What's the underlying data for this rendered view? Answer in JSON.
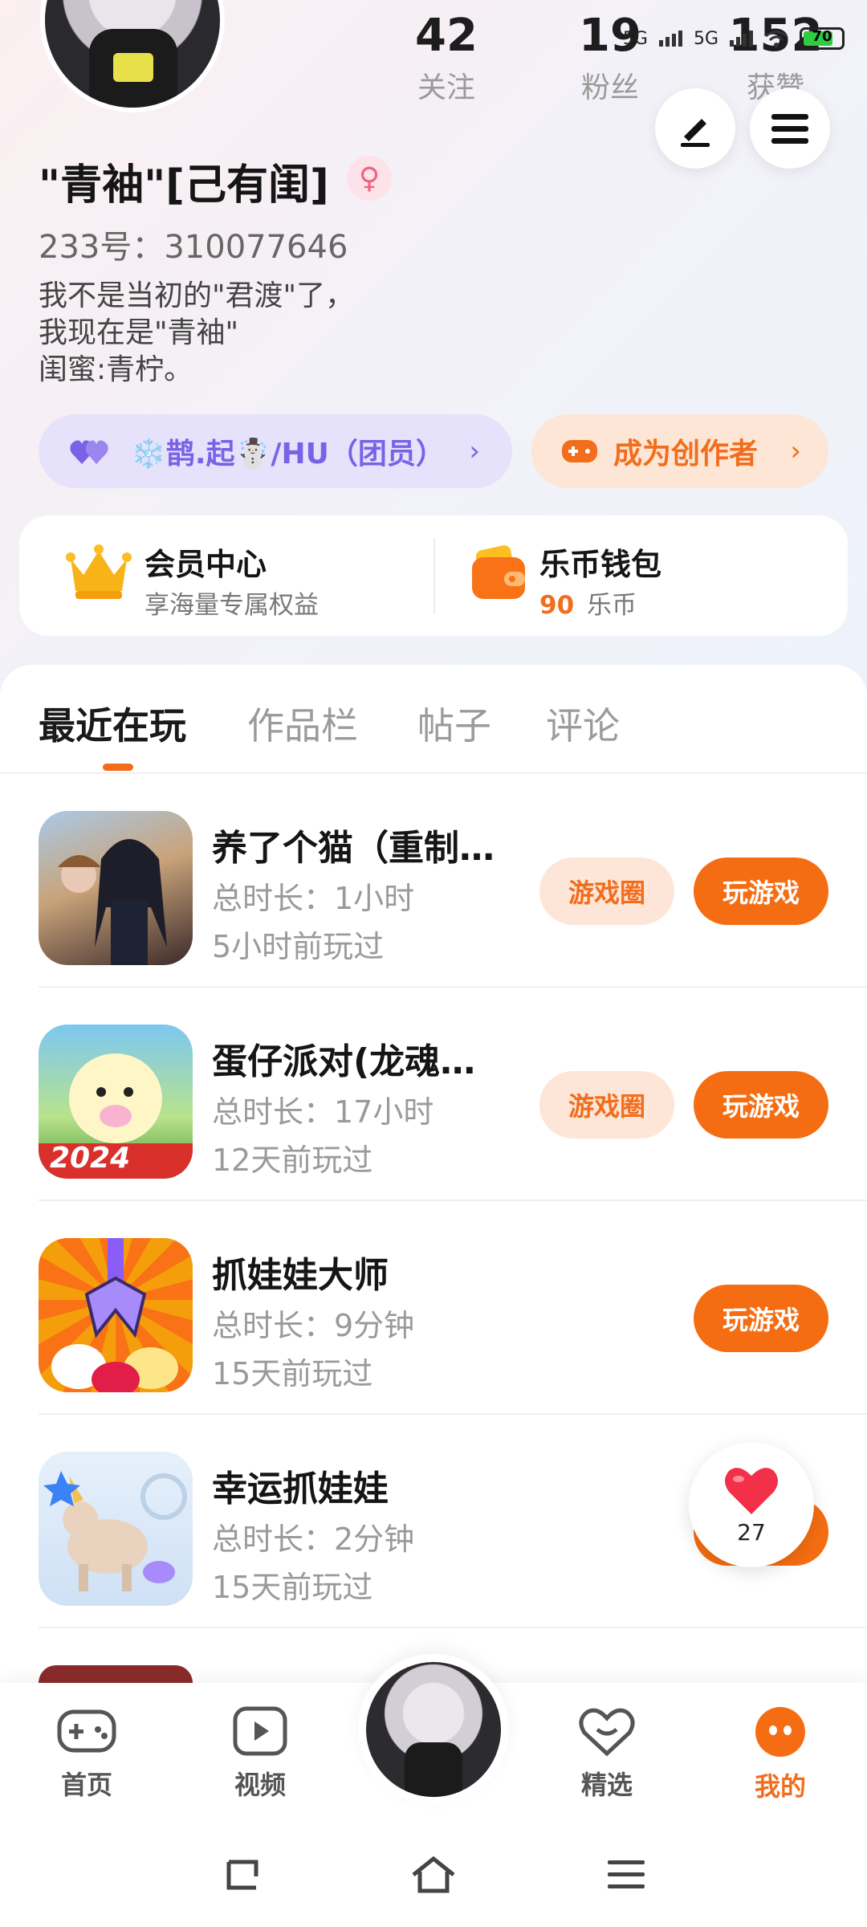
{
  "status_bar": {
    "network1": "5G",
    "network2": "5G",
    "battery": "70"
  },
  "profile": {
    "name": "\"青袖\"[己有闺]",
    "gender_symbol": "♀",
    "uid": "233号：310077646",
    "bio": "我不是当初的\"君渡\"了，\n我现在是\"青袖\"\n闺蜜:青柠。",
    "stats": [
      {
        "value": "42",
        "label": "关注"
      },
      {
        "value": "19",
        "label": "粉丝"
      },
      {
        "value": "152",
        "label": "获赞"
      }
    ]
  },
  "chips": {
    "team_label": "❄️鹊.起☃️/HU（团员）",
    "team_arrow": "›",
    "creator_label": "成为创作者",
    "creator_arrow": "›"
  },
  "cards": {
    "vip_title": "会员中心",
    "vip_sub": "享海量专属权益",
    "wallet_title": "乐币钱包",
    "wallet_amount": "90",
    "wallet_unit": "乐币"
  },
  "tabs": [
    "最近在玩",
    "作品栏",
    "帖子",
    "评论"
  ],
  "games": [
    {
      "title": "养了个猫（重制…",
      "duration": "总时长：1小时",
      "last_played": "5小时前玩过",
      "circle_label": "游戏圈",
      "play_label": "玩游戏"
    },
    {
      "title": "蛋仔派对(龙魂…",
      "duration": "总时长：17小时",
      "last_played": "12天前玩过",
      "circle_label": "游戏圈",
      "play_label": "玩游戏",
      "badge": "2024"
    },
    {
      "title": "抓娃娃大师",
      "duration": "总时长：9分钟",
      "last_played": "15天前玩过",
      "play_label": "玩游戏"
    },
    {
      "title": "幸运抓娃娃",
      "duration": "总时长：2分钟",
      "last_played": "15天前玩过",
      "play_label": "玩游戏"
    }
  ],
  "like_bubble": {
    "count": "27"
  },
  "bottom_nav": {
    "items": [
      {
        "label": "首页",
        "icon": "gamepad-icon"
      },
      {
        "label": "视频",
        "icon": "video-play-icon"
      },
      {
        "label": "精选",
        "icon": "heart-chat-icon"
      },
      {
        "label": "我的",
        "icon": "profile-face-icon"
      }
    ],
    "active": "我的"
  },
  "colors": {
    "accent": "#f56d12",
    "purple": "#7a62e6",
    "muted": "#9a9a9a"
  }
}
